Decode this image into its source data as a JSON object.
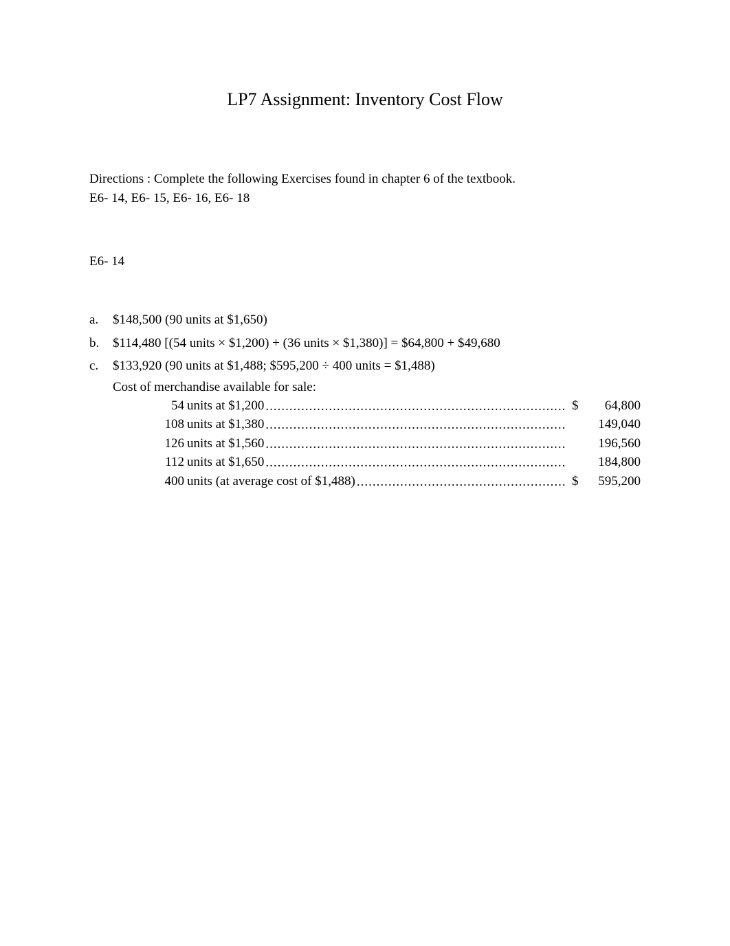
{
  "title": "LP7 Assignment: Inventory Cost Flow",
  "directions_line1": "Directions : Complete the following Exercises found in chapter 6 of the textbook.",
  "directions_line2": "E6- 14, E6- 15, E6- 16, E6- 18",
  "section_label": "E6- 14",
  "items": {
    "a_marker": "a.",
    "a_text": "$148,500 (90 units at $1,650)",
    "b_marker": "b.",
    "b_text": "$114,480 [(54 units × $1,200) + (36 units × $1,380)] = $64,800 + $49,680",
    "c_marker": "c.",
    "c_text": "$133,920 (90 units at $1,488; $595,200 ÷ 400 units = $1,488)"
  },
  "subhead": "Cost of merchandise available for sale:",
  "lines": [
    {
      "qty": "54",
      "label": "units at $1,200",
      "dollar": "$",
      "amount": "64,800"
    },
    {
      "qty": "108",
      "label": "units at $1,380",
      "dollar": "",
      "amount": "149,040"
    },
    {
      "qty": "126",
      "label": "units at $1,560",
      "dollar": "",
      "amount": "196,560"
    },
    {
      "qty": "112",
      "label": "units at $1,650",
      "dollar": "",
      "amount": "184,800"
    },
    {
      "qty": "400",
      "label": "units (at average cost of $1,488)",
      "dollar": "$",
      "amount": "595,200"
    }
  ],
  "dots": "..........................................................................................................."
}
